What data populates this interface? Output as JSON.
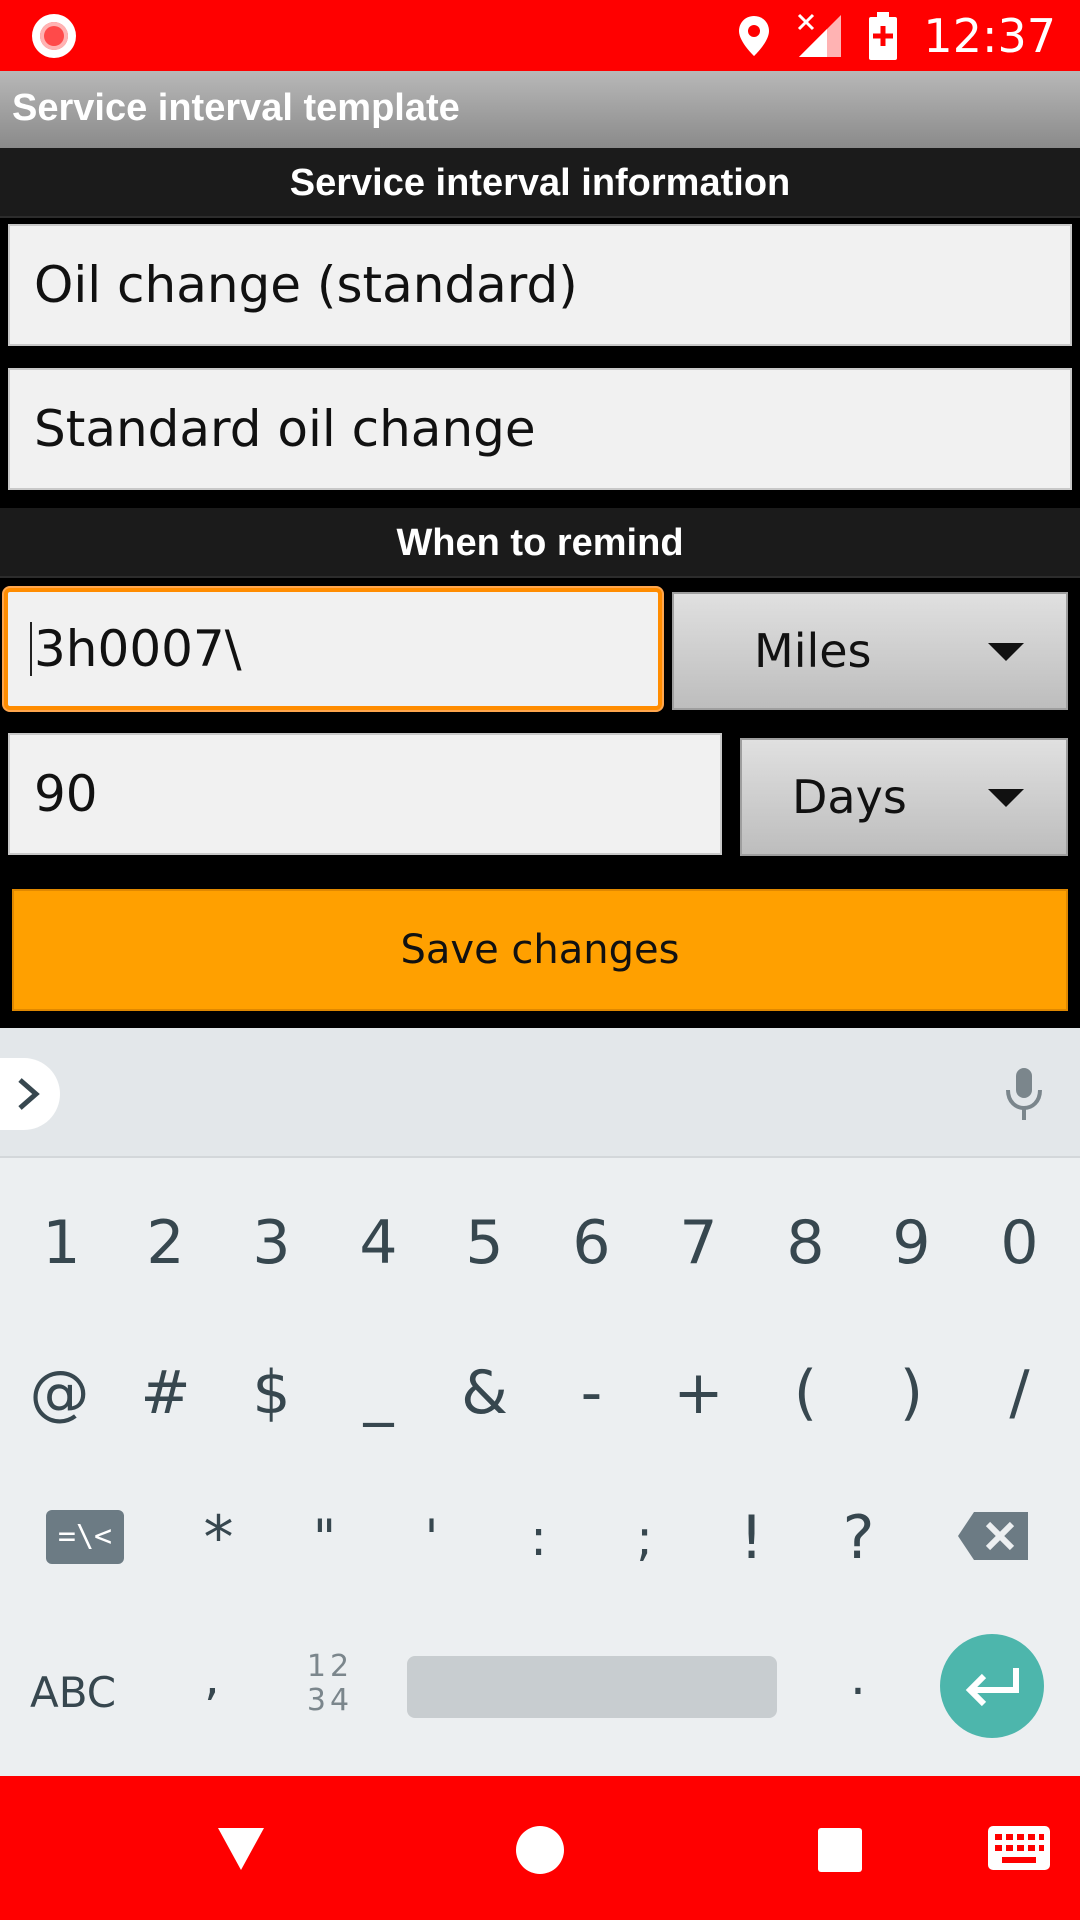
{
  "status_bar": {
    "time": "12:37",
    "icons": [
      "screen-record-icon",
      "location-icon",
      "signal-no-data-icon",
      "battery-charging-icon"
    ]
  },
  "app_bar": {
    "title": "Service interval template"
  },
  "sections": {
    "info_header": "Service interval information",
    "remind_header": "When to remind"
  },
  "form": {
    "name_value": "Oil change (standard)",
    "description_value": "Standard oil change",
    "distance_value": "3h0007\\",
    "distance_unit": "Miles",
    "time_value": "90",
    "time_unit": "Days",
    "save_label": "Save changes"
  },
  "keyboard": {
    "row1": [
      "1",
      "2",
      "3",
      "4",
      "5",
      "6",
      "7",
      "8",
      "9",
      "0"
    ],
    "row2": [
      "@",
      "#",
      "$",
      "_",
      "&",
      "-",
      "+",
      "(",
      ")",
      "/"
    ],
    "row3": [
      "*",
      "\"",
      "'",
      ":",
      ";",
      "!",
      "?"
    ],
    "symbols_key": "=\\<",
    "abc_key": "ABC",
    "comma_key": ",",
    "num_key_top": "12",
    "num_key_bottom": "34",
    "period_key": "."
  },
  "colors": {
    "status_bar": "#ff0000",
    "nav_bar": "#ff0000",
    "save_button": "#ffa000",
    "focus_ring": "#ff8c00",
    "enter_key": "#4db6ac"
  }
}
